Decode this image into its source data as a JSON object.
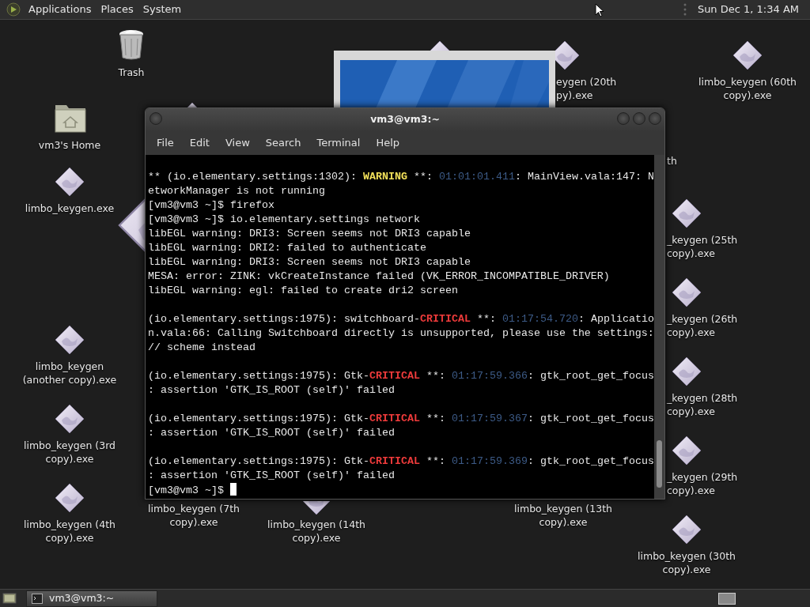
{
  "top_panel": {
    "menus": [
      "Applications",
      "Places",
      "System"
    ],
    "clock": "Sun Dec 1, 1:34 AM"
  },
  "desktop_icons": [
    {
      "kind": "trash",
      "lines": [
        "Trash"
      ]
    },
    {
      "kind": "home",
      "lines": [
        "vm3's Home"
      ]
    },
    {
      "kind": "app",
      "lines": [
        "limbo_keygen.exe"
      ]
    },
    {
      "kind": "app",
      "lines": [
        "limbo_keygen",
        "(another copy).exe"
      ]
    },
    {
      "kind": "app",
      "lines": [
        "limbo_keygen (3rd",
        "copy).exe"
      ]
    },
    {
      "kind": "app",
      "lines": [
        "limbo_keygen (4th",
        "copy).exe"
      ]
    },
    {
      "kind": "app",
      "lines": [
        "limbo_keygen (7th",
        "copy).exe"
      ]
    },
    {
      "kind": "app",
      "lines": [
        "limbo_keygen (14th",
        "copy).exe"
      ]
    },
    {
      "kind": "app",
      "lines": [
        "limbo_keygen (13th",
        "copy).exe"
      ]
    },
    {
      "kind": "app",
      "lines": [
        "_keygen (25th",
        "copy).exe"
      ]
    },
    {
      "kind": "app",
      "lines": [
        "_keygen (26th",
        "copy).exe"
      ]
    },
    {
      "kind": "app",
      "lines": [
        "_keygen (28th",
        "copy).exe"
      ]
    },
    {
      "kind": "app",
      "lines": [
        "_keygen (29th",
        "copy).exe"
      ]
    },
    {
      "kind": "app",
      "lines": [
        "limbo_keygen (30th",
        "copy).exe"
      ]
    },
    {
      "kind": "app",
      "lines": [
        "eygen (20th",
        "py).exe"
      ]
    },
    {
      "kind": "app",
      "lines": [
        "limbo_keygen (60th",
        "copy).exe"
      ]
    },
    {
      "kind": "app",
      "lines": [
        "th"
      ]
    },
    {
      "kind": "monitor"
    },
    {
      "kind": "app"
    },
    {
      "kind": "app"
    },
    {
      "kind": "app"
    }
  ],
  "terminal": {
    "title": "vm3@vm3:~",
    "menu": [
      "File",
      "Edit",
      "View",
      "Search",
      "Terminal",
      "Help"
    ],
    "cursor_visible": true,
    "blocks": [
      [
        [
          {
            "kind": "plain",
            "text": "** (io.elementary.settings:1302): "
          },
          {
            "kind": "warning",
            "text": "WARNING"
          },
          {
            "kind": "plain",
            "text": " **: "
          },
          {
            "kind": "timestamp",
            "text": "01:01:01.411"
          },
          {
            "kind": "plain",
            "text": ": MainView.vala:147: N"
          }
        ],
        [
          {
            "kind": "plain",
            "text": "etworkManager is not running"
          }
        ],
        [
          {
            "kind": "plain",
            "text": "[vm3@vm3 ~]$ firefox"
          }
        ],
        [
          {
            "kind": "plain",
            "text": "[vm3@vm3 ~]$ io.elementary.settings network"
          }
        ],
        [
          {
            "kind": "plain",
            "text": "libEGL warning: DRI3: Screen seems not DRI3 capable"
          }
        ],
        [
          {
            "kind": "plain",
            "text": "libEGL warning: DRI2: failed to authenticate"
          }
        ],
        [
          {
            "kind": "plain",
            "text": "libEGL warning: DRI3: Screen seems not DRI3 capable"
          }
        ],
        [
          {
            "kind": "plain",
            "text": "MESA: error: ZINK: vkCreateInstance failed (VK_ERROR_INCOMPATIBLE_DRIVER)"
          }
        ],
        [
          {
            "kind": "plain",
            "text": "libEGL warning: egl: failed to create dri2 screen"
          }
        ]
      ],
      [
        [
          {
            "kind": "plain",
            "text": "(io.elementary.settings:1975): switchboard-"
          },
          {
            "kind": "critical",
            "text": "CRITICAL"
          },
          {
            "kind": "plain",
            "text": " **: "
          },
          {
            "kind": "timestamp",
            "text": "01:17:54.720"
          },
          {
            "kind": "plain",
            "text": ": Applicatio"
          }
        ],
        [
          {
            "kind": "plain",
            "text": "n.vala:66: Calling Switchboard directly is unsupported, please use the settings:"
          }
        ],
        [
          {
            "kind": "plain",
            "text": "// scheme instead"
          }
        ]
      ],
      [
        [
          {
            "kind": "plain",
            "text": "(io.elementary.settings:1975): Gtk-"
          },
          {
            "kind": "critical",
            "text": "CRITICAL"
          },
          {
            "kind": "plain",
            "text": " **: "
          },
          {
            "kind": "timestamp",
            "text": "01:17:59.366"
          },
          {
            "kind": "plain",
            "text": ": gtk_root_get_focus"
          }
        ],
        [
          {
            "kind": "plain",
            "text": ": assertion 'GTK_IS_ROOT (self)' failed"
          }
        ]
      ],
      [
        [
          {
            "kind": "plain",
            "text": "(io.elementary.settings:1975): Gtk-"
          },
          {
            "kind": "critical",
            "text": "CRITICAL"
          },
          {
            "kind": "plain",
            "text": " **: "
          },
          {
            "kind": "timestamp",
            "text": "01:17:59.367"
          },
          {
            "kind": "plain",
            "text": ": gtk_root_get_focus"
          }
        ],
        [
          {
            "kind": "plain",
            "text": ": assertion 'GTK_IS_ROOT (self)' failed"
          }
        ]
      ],
      [
        [
          {
            "kind": "plain",
            "text": "(io.elementary.settings:1975): Gtk-"
          },
          {
            "kind": "critical",
            "text": "CRITICAL"
          },
          {
            "kind": "plain",
            "text": " **: "
          },
          {
            "kind": "timestamp",
            "text": "01:17:59.369"
          },
          {
            "kind": "plain",
            "text": ": gtk_root_get_focus"
          }
        ],
        [
          {
            "kind": "plain",
            "text": ": assertion 'GTK_IS_ROOT (self)' failed"
          }
        ],
        [
          {
            "kind": "plain",
            "text": "[vm3@vm3 ~]$ "
          }
        ]
      ]
    ]
  },
  "taskbar": {
    "items": [
      "vm3@vm3:~"
    ]
  }
}
